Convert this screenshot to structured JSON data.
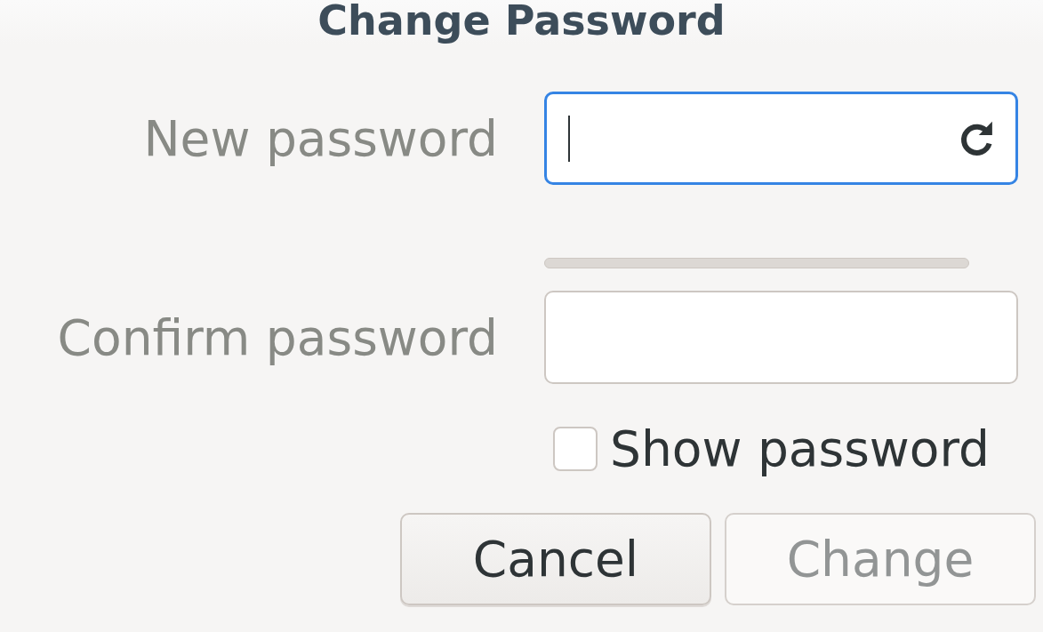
{
  "window": {
    "title": "Change Password"
  },
  "fields": [
    {
      "label": "New password",
      "focused": true,
      "has_generate_icon": true
    },
    {
      "label": "Confirm password",
      "focused": false,
      "has_generate_icon": false
    }
  ],
  "strength_meter": {
    "level": 0
  },
  "show_password": {
    "label": "Show password",
    "checked": false
  },
  "buttons": [
    {
      "label": "Cancel",
      "disabled": false
    },
    {
      "label": "Change",
      "disabled": true
    }
  ]
}
